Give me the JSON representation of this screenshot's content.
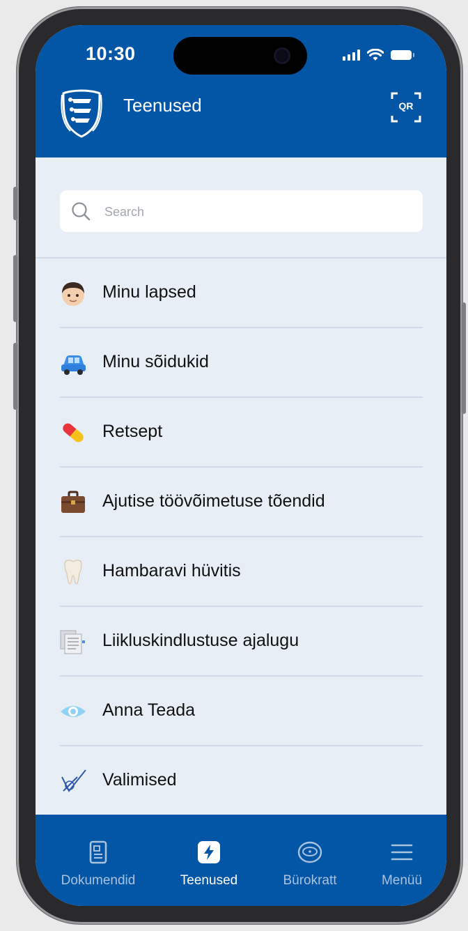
{
  "status_bar": {
    "time": "10:30"
  },
  "header": {
    "title": "Teenused",
    "qr_label": "QR",
    "logo_icon": "estonia-coat-of-arms-icon",
    "background_color": "#0356a5"
  },
  "search": {
    "placeholder": "Search",
    "value": ""
  },
  "services": [
    {
      "label": "Minu lapsed",
      "icon": "child-face-icon"
    },
    {
      "label": "Minu sõidukid",
      "icon": "car-icon"
    },
    {
      "label": "Retsept",
      "icon": "pill-icon"
    },
    {
      "label": "Ajutise töövõimetuse tõendid",
      "icon": "briefcase-icon"
    },
    {
      "label": "Hambaravi hüvitis",
      "icon": "tooth-icon"
    },
    {
      "label": "Liikluskindlustuse ajalugu",
      "icon": "document-stack-icon"
    },
    {
      "label": "Anna Teada",
      "icon": "eye-icon"
    },
    {
      "label": "Valimised",
      "icon": "ballot-check-icon"
    }
  ],
  "tabbar": {
    "tabs": [
      {
        "label": "Dokumendid",
        "icon": "document-icon",
        "active": false
      },
      {
        "label": "Teenused",
        "icon": "lightning-icon",
        "active": true
      },
      {
        "label": "Bürokratt",
        "icon": "burokratt-icon",
        "active": false
      },
      {
        "label": "Menüü",
        "icon": "hamburger-menu-icon",
        "active": false
      }
    ],
    "active_color": "#ffffff",
    "inactive_color": "#a9c2de"
  }
}
